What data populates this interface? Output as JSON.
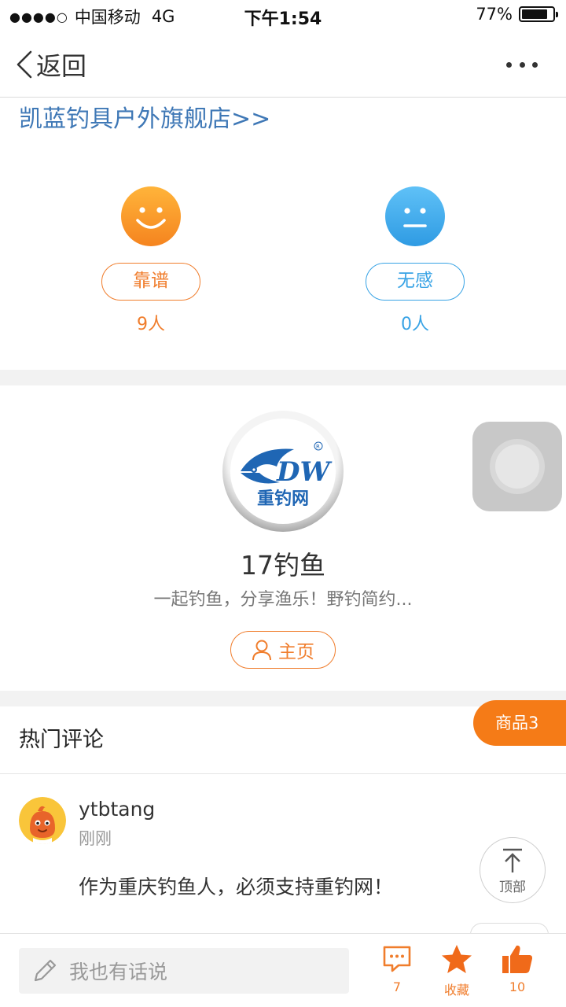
{
  "status_bar": {
    "signal_dots": "●●●●○",
    "carrier": "中国移动",
    "network": "4G",
    "time": "下午1:54",
    "battery_percent": "77%",
    "battery_level": 0.77
  },
  "navbar": {
    "back_label": "返回",
    "more_icon": "ellipsis-icon"
  },
  "store_link": "凯蓝钓具户外旗舰店>>",
  "reactions": [
    {
      "label": "靠谱",
      "count": "9人",
      "icon": "smiley-face-icon",
      "color": "#f07d2c"
    },
    {
      "label": "无感",
      "count": "0人",
      "icon": "neutral-face-icon",
      "color": "#38a3e5"
    }
  ],
  "profile": {
    "logo_text": "重钓网",
    "logo_letters": "DW",
    "name": "17钓鱼",
    "description": "一起钓鱼，分享渔乐！野钓简约...",
    "home_button": "主页"
  },
  "hot_comments": {
    "title": "热门评论",
    "goods_badge": "商品3",
    "items": [
      {
        "user": "ytbtang",
        "time": "刚刚",
        "text": "作为重庆钓鱼人，必须支持重钓网！"
      }
    ]
  },
  "top_button": "顶部",
  "bottom_bar": {
    "input_placeholder": "我也有话说",
    "comment_count": "7",
    "favorite_label": "收藏",
    "like_count": "10"
  },
  "colors": {
    "accent_orange": "#f07d2c",
    "accent_blue": "#38a3e5",
    "link_blue": "#3f78b6",
    "badge_orange": "#f57b17"
  }
}
